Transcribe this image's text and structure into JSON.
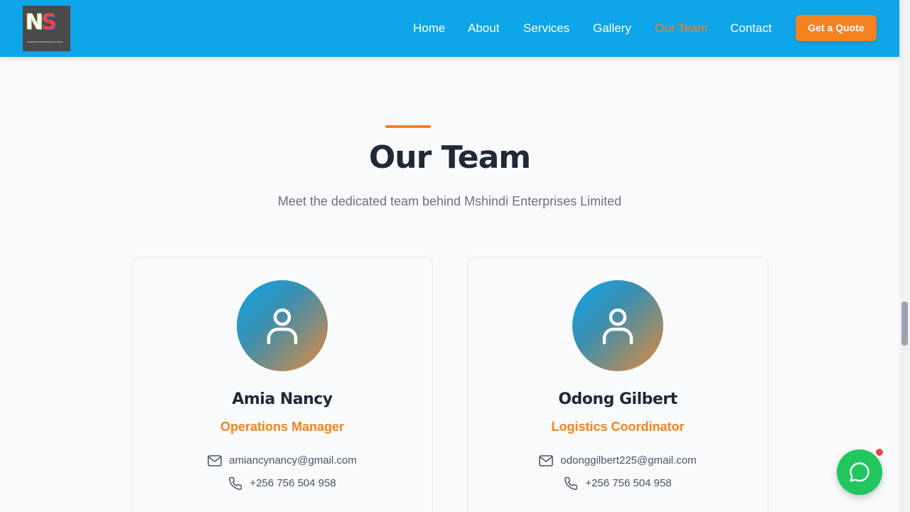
{
  "header": {
    "logo": {
      "text": "MSHINDI ENTERPRISES LIMITED",
      "icon": "logo-icon"
    },
    "nav": [
      {
        "label": "Home",
        "active": false
      },
      {
        "label": "About",
        "active": false
      },
      {
        "label": "Services",
        "active": false
      },
      {
        "label": "Gallery",
        "active": false
      },
      {
        "label": "Our Team",
        "active": true
      },
      {
        "label": "Contact",
        "active": false
      }
    ],
    "cta_label": "Get a Quote"
  },
  "section": {
    "title": "Our Team",
    "subtitle": "Meet the dedicated team behind Mshindi Enterprises Limited"
  },
  "team": [
    {
      "name": "Amia Nancy",
      "role": "Operations Manager",
      "email": "amiancynancy@gmail.com",
      "phone": "+256 756 504 958"
    },
    {
      "name": "Odong Gilbert",
      "role": "Logistics Coordinator",
      "email": "odonggilbert225@gmail.com",
      "phone": "+256 756 504 958"
    }
  ],
  "icons": {
    "avatar": "user-icon",
    "email": "mail-icon",
    "phone": "phone-icon",
    "chat": "whatsapp-icon"
  },
  "colors": {
    "header_bg": "#0ea5e9",
    "accent": "#f58220",
    "chat_bg": "#22c55e",
    "notification": "#ef4444"
  }
}
